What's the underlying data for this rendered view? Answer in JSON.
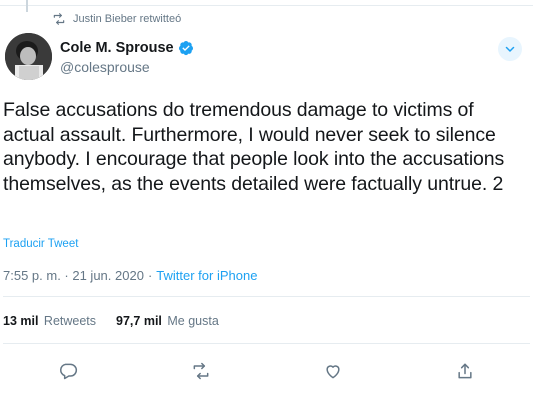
{
  "retweet_context": {
    "label": "Justin Bieber retwitteó",
    "icon": "retweet-icon"
  },
  "author": {
    "display_name": "Cole M. Sprouse",
    "handle": "@colesprouse",
    "verified": true,
    "verified_icon": "verified-badge-icon"
  },
  "tweet": {
    "text": "False accusations do tremendous damage to victims of actual assault. Furthermore, I would never seek to silence anybody. I encourage that people look into the accusations themselves, as the events detailed were factually untrue. 2",
    "translate_label": "Traducir Tweet",
    "timestamp": "7:55 p. m. · 21 jun. 2020",
    "separator": "·",
    "source": "Twitter for iPhone"
  },
  "stats": {
    "retweets_count": "13 mil",
    "retweets_label": "Retweets",
    "likes_count": "97,7 mil",
    "likes_label": "Me gusta"
  },
  "actions": [
    "reply-icon",
    "retweet-icon",
    "like-icon",
    "share-icon"
  ],
  "colors": {
    "accent": "#1da1f2",
    "muted": "#657786",
    "text": "#14171a",
    "divider": "#e6ecf0"
  }
}
